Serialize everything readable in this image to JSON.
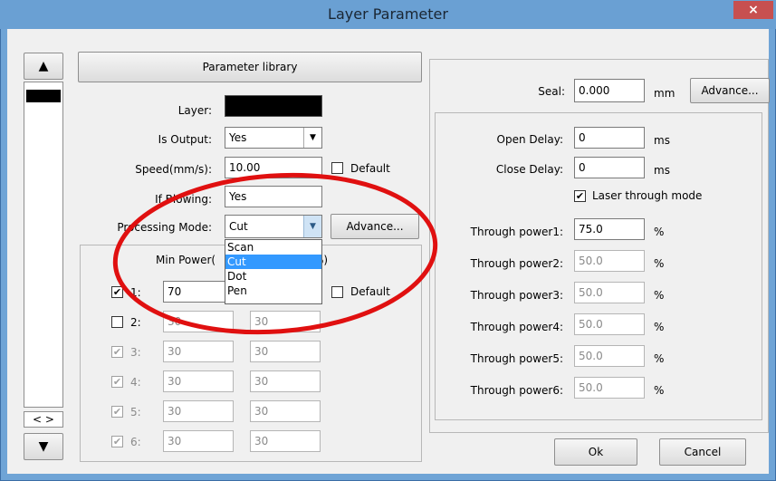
{
  "window": {
    "title": "Layer Parameter",
    "close": "×"
  },
  "left_panel": {
    "up_arrow": "▲",
    "down_arrow": "▼",
    "scroll_lr": "< >"
  },
  "top": {
    "param_lib": "Parameter library",
    "layer_label": "Layer:",
    "layer_color": "#000000",
    "is_output_label": "Is Output:",
    "is_output_value": "Yes",
    "speed_label": "Speed(mm/s):",
    "speed_value": "10.00",
    "default_label": "Default",
    "blowing_label": "If Blowing:",
    "blowing_value": "Yes",
    "mode_label": "Processing Mode:",
    "mode_value": "Cut",
    "advance": "Advance...",
    "mode_options": [
      "Scan",
      "Cut",
      "Dot",
      "Pen"
    ],
    "selected_option": "Cut"
  },
  "power": {
    "min_label": "Min Power(",
    "max_label": "%)",
    "default_label": "Default",
    "rows": [
      {
        "num": "1:",
        "checked": "✔",
        "min": "70",
        "max": ""
      },
      {
        "num": "2:",
        "checked": "",
        "min": "30",
        "max": "30"
      },
      {
        "num": "3:",
        "checked": "✔",
        "min": "30",
        "max": "30"
      },
      {
        "num": "4:",
        "checked": "✔",
        "min": "30",
        "max": "30"
      },
      {
        "num": "5:",
        "checked": "✔",
        "min": "30",
        "max": "30"
      },
      {
        "num": "6:",
        "checked": "✔",
        "min": "30",
        "max": "30"
      }
    ]
  },
  "right": {
    "seal_label": "Seal:",
    "seal_value": "0.000",
    "unit_mm": "mm",
    "advance": "Advance...",
    "open_delay_label": "Open Delay:",
    "open_delay_value": "0",
    "close_delay_label": "Close Delay:",
    "close_delay_value": "0",
    "unit_ms": "ms",
    "laser_through": "Laser through mode",
    "laser_check": "✔",
    "through": [
      {
        "label": "Through power1:",
        "value": "75.0",
        "unit": "%"
      },
      {
        "label": "Through power2:",
        "value": "50.0",
        "unit": "%"
      },
      {
        "label": "Through power3:",
        "value": "50.0",
        "unit": "%"
      },
      {
        "label": "Through power4:",
        "value": "50.0",
        "unit": "%"
      },
      {
        "label": "Through power5:",
        "value": "50.0",
        "unit": "%"
      },
      {
        "label": "Through power6:",
        "value": "50.0",
        "unit": "%"
      }
    ]
  },
  "buttons": {
    "ok": "Ok",
    "cancel": "Cancel"
  },
  "colors": {
    "title_bar": "#6aa0d3",
    "selection": "#3399ff",
    "annotation": "#e01010"
  }
}
